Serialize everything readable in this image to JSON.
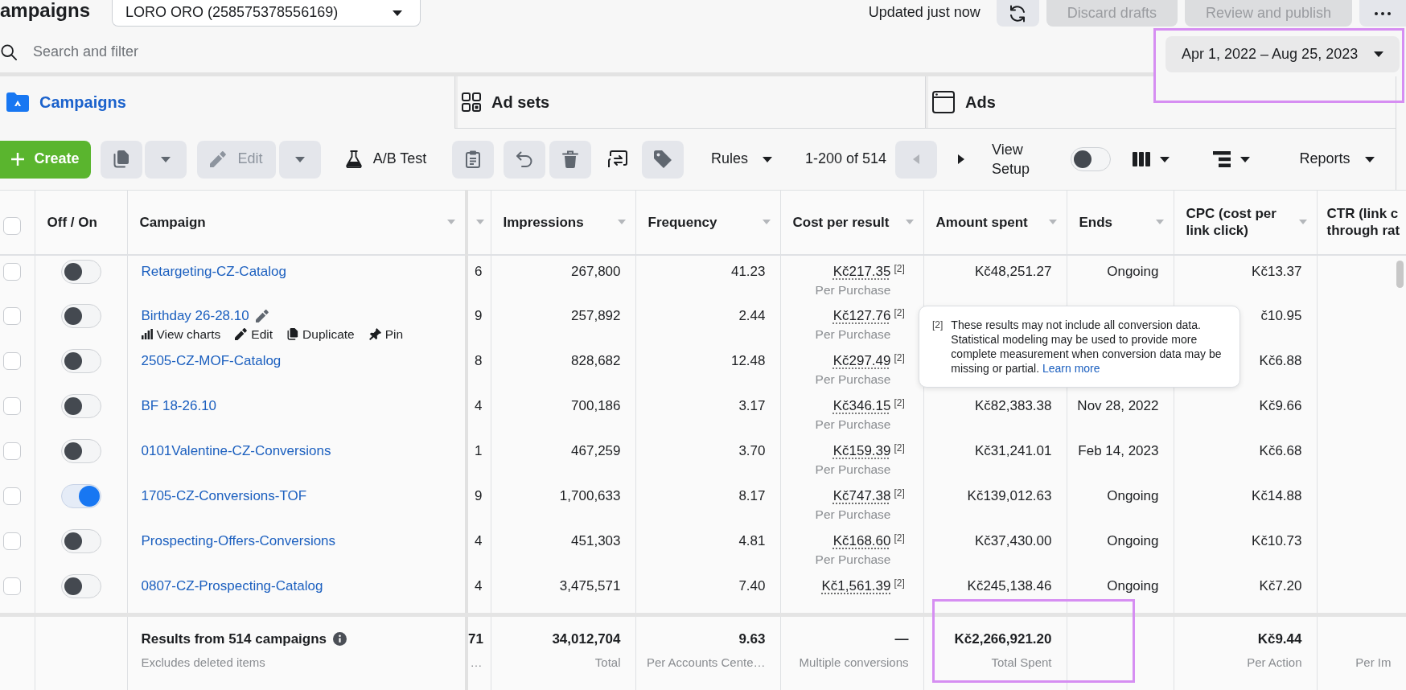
{
  "header": {
    "title": "ampaigns",
    "account": "LORO ORO (258575378556169)",
    "updated": "Updated just now",
    "buttons": [
      {
        "label": "Discard drafts",
        "disabled": true
      },
      {
        "label": "Review and publish",
        "disabled": true
      }
    ]
  },
  "search": {
    "placeholder": "Search and filter"
  },
  "date_range": {
    "label": "Apr 1, 2022 – Aug 25, 2023",
    "highlighted": true
  },
  "tabs": [
    {
      "label": "Campaigns",
      "selected": true
    },
    {
      "label": "Ad sets",
      "selected": false
    },
    {
      "label": "Ads",
      "selected": false
    }
  ],
  "toolbar": {
    "create": "Create",
    "edit": {
      "label": "Edit",
      "disabled": true
    },
    "ab_test": "A/B Test",
    "rules": "Rules",
    "pager": {
      "range": "1-200 of 514",
      "prev_disabled": true,
      "next_disabled": false
    },
    "view_setup": {
      "label": "View Setup",
      "on": false
    },
    "reports": "Reports"
  },
  "table": {
    "all_checked": false,
    "toggle_column": {
      "label": "Off / On"
    },
    "name_column": {
      "label": "Campaign",
      "sortable": true
    },
    "columns": [
      {
        "sortable": true
      },
      {
        "label": "Impressions",
        "sortable": true
      },
      {
        "label": "Frequency",
        "sortable": true
      },
      {
        "label": "Cost per result",
        "sortable": true
      },
      {
        "label": "Amount spent",
        "sortable": true
      },
      {
        "label": "Ends",
        "sortable": true
      },
      {
        "label": "CPC (cost per link click)",
        "sortable": true
      },
      {
        "label": "CTR (link c\nthrough rat",
        "sortable": false
      }
    ],
    "rows": [
      {
        "checked": false,
        "on": false,
        "hovered": false,
        "campaign": "Retargeting-CZ-Catalog",
        "cells": [
          "6",
          "267,800",
          "41.23",
          {
            "kind": "result",
            "value": "Kč217.35",
            "footnote": "[2]",
            "note": "Per Purchase"
          },
          "Kč48,251.27",
          {
            "kind": "status",
            "value": "Ongoing"
          },
          "Kč13.37"
        ]
      },
      {
        "checked": false,
        "on": false,
        "hovered": true,
        "campaign": "Birthday 26-28.10",
        "actions": [
          "View charts",
          "Edit",
          "Duplicate",
          "Pin"
        ],
        "cells": [
          "9",
          "257,892",
          "2.44",
          {
            "kind": "result",
            "value": "Kč127.76",
            "footnote": "[2]",
            "note": "Per Purchase"
          },
          null,
          null,
          "č10.95"
        ]
      },
      {
        "checked": false,
        "on": false,
        "hovered": false,
        "campaign": "2505-CZ-MOF-Catalog",
        "cells": [
          "8",
          "828,682",
          "12.48",
          {
            "kind": "result",
            "value": "Kč297.49",
            "footnote": "[2]",
            "note": "Per Purchase"
          },
          null,
          null,
          "Kč6.88"
        ]
      },
      {
        "checked": false,
        "on": false,
        "hovered": false,
        "campaign": "BF 18-26.10",
        "cells": [
          "4",
          "700,186",
          "3.17",
          {
            "kind": "result",
            "value": "Kč346.15",
            "footnote": "[2]",
            "note": "Per Purchase"
          },
          "Kč82,383.38",
          {
            "kind": "date",
            "value": "Nov 28, 2022"
          },
          "Kč9.66"
        ]
      },
      {
        "checked": false,
        "on": false,
        "hovered": false,
        "campaign": "0101Valentine-CZ-Conversions",
        "cells": [
          "1",
          "467,259",
          "3.70",
          {
            "kind": "result",
            "value": "Kč159.39",
            "footnote": "[2]",
            "note": "Per Purchase"
          },
          "Kč31,241.01",
          {
            "kind": "date",
            "value": "Feb 14, 2023"
          },
          "Kč6.68"
        ]
      },
      {
        "checked": false,
        "on": true,
        "hovered": false,
        "campaign": "1705-CZ-Conversions-TOF",
        "cells": [
          "9",
          "1,700,633",
          "8.17",
          {
            "kind": "result",
            "value": "Kč747.38",
            "footnote": "[2]",
            "note": "Per Purchase"
          },
          "Kč139,012.63",
          {
            "kind": "status",
            "value": "Ongoing"
          },
          "Kč14.88"
        ]
      },
      {
        "checked": false,
        "on": false,
        "hovered": false,
        "campaign": "Prospecting-Offers-Conversions",
        "cells": [
          "4",
          "451,303",
          "4.81",
          {
            "kind": "result",
            "value": "Kč168.60",
            "footnote": "[2]",
            "note": "Per Purchase"
          },
          "Kč37,430.00",
          {
            "kind": "status",
            "value": "Ongoing"
          },
          "Kč10.73"
        ]
      },
      {
        "checked": false,
        "on": false,
        "hovered": false,
        "campaign": "0807-CZ-Prospecting-Catalog",
        "cells": [
          "4",
          "3,475,571",
          "7.40",
          {
            "kind": "result",
            "value": "Kč1,561.39",
            "footnote": "[2]"
          },
          "Kč245,138.46",
          {
            "kind": "status",
            "value": "Ongoing"
          },
          "Kč7.20"
        ]
      }
    ],
    "footer": {
      "title": "Results from 514 campaigns",
      "note": "Excludes deleted items",
      "cells": [
        {
          "value": "71",
          "note": "…"
        },
        {
          "value": "34,012,704",
          "note": "Total"
        },
        {
          "value": "9.63",
          "note": "Per Accounts Cente…"
        },
        {
          "value": "—",
          "note": "Multiple conversions"
        },
        {
          "value": "Kč2,266,921.20",
          "note": "Total Spent",
          "highlighted": true
        },
        null,
        {
          "value": "Kč9.44",
          "note": "Per Action"
        },
        {
          "note": "Per Im"
        }
      ]
    }
  },
  "tooltip": {
    "mark": "[2]",
    "text": "These results may not include all conversion data. Statistical modeling may be used to provide more complete measurement when conversion data may be missing or partial.",
    "link": "Learn more"
  }
}
